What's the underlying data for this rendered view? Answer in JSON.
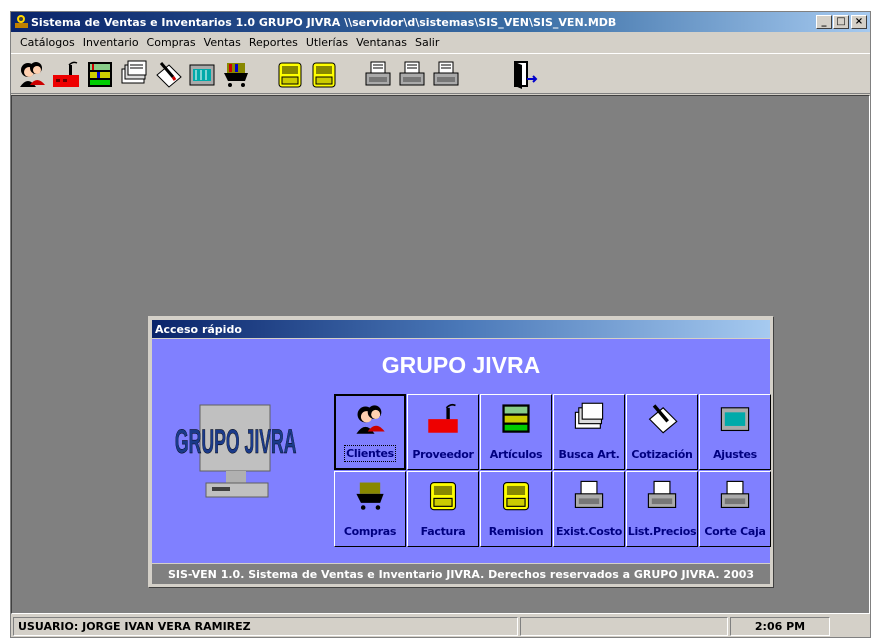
{
  "window": {
    "title": "Sistema de Ventas e Inventarios 1.0  GRUPO JIVRA   \\\\servidor\\d\\sistemas\\SIS_VEN\\SIS_VEN.MDB",
    "buttons": [
      "_",
      "□",
      "×"
    ]
  },
  "menu": [
    "Catálogos",
    "Inventario",
    "Compras",
    "Ventas",
    "Reportes",
    "Utlerías",
    "Ventanas",
    "Salir"
  ],
  "toolbar": {
    "icons": [
      "people-icon",
      "factory-icon",
      "shelves-icon",
      "card-file-icon",
      "pen-paper-icon",
      "keypad-icon",
      "cart-icon",
      "register-icon",
      "register-icon",
      "printer-icon",
      "printer-icon",
      "printer-icon",
      "exit-door-icon"
    ]
  },
  "quick_access": {
    "title": "Acceso rápido",
    "heading": "GRUPO JIVRA",
    "logo_text": "GRUPO JIVRA",
    "buttons": [
      {
        "label": "Clientes",
        "icon": "people-icon"
      },
      {
        "label": "Proveedor",
        "icon": "factory-icon"
      },
      {
        "label": "Artículos",
        "icon": "shelves-icon"
      },
      {
        "label": "Busca Art.",
        "icon": "card-file-icon"
      },
      {
        "label": "Cotización",
        "icon": "pen-paper-icon"
      },
      {
        "label": "Ajustes",
        "icon": "keypad-icon"
      },
      {
        "label": "Compras",
        "icon": "cart-icon"
      },
      {
        "label": "Factura",
        "icon": "register-icon"
      },
      {
        "label": "Remision",
        "icon": "register-icon"
      },
      {
        "label": "Exist.Costo",
        "icon": "printer-icon"
      },
      {
        "label": "List.Precios",
        "icon": "printer-icon"
      },
      {
        "label": "Corte Caja",
        "icon": "printer-icon"
      }
    ],
    "footer": "SIS-VEN 1.0. Sistema de Ventas e Inventario JIVRA.  Derechos reservados a GRUPO JIVRA. 2003"
  },
  "status": {
    "user": "USUARIO: JORGE IVAN VERA RAMIREZ",
    "time": "2:06 PM"
  }
}
